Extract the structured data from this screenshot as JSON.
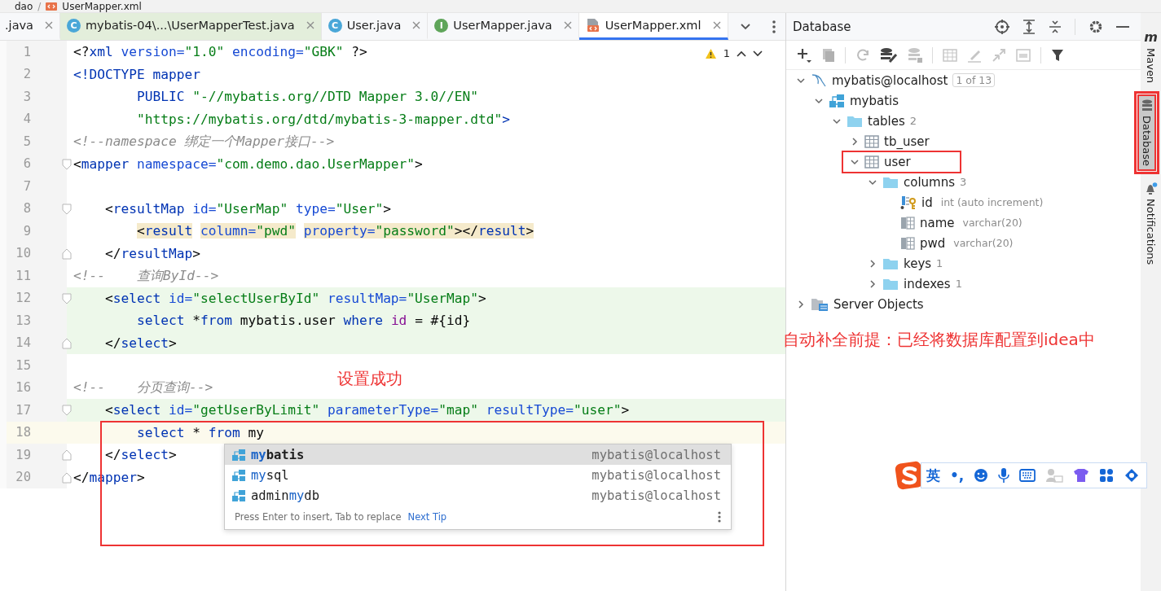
{
  "breadcrumbs": {
    "items": [
      "dao",
      "UserMapper.xml"
    ],
    "separator": "/"
  },
  "tabs": [
    {
      "label": ".java",
      "kind": "plain",
      "selected": false
    },
    {
      "label": "mybatis-04\\...\\UserMapperTest.java",
      "kind": "class",
      "glyph": "C",
      "selected": false,
      "color": "#e3eedb"
    },
    {
      "label": "User.java",
      "kind": "class",
      "glyph": "C",
      "selected": false
    },
    {
      "label": "UserMapper.java",
      "kind": "interface",
      "glyph": "I",
      "selected": false
    },
    {
      "label": "UserMapper.xml",
      "kind": "xml",
      "selected": true
    }
  ],
  "editor": {
    "warnings": {
      "count": "1"
    },
    "annotation_box": true,
    "annotation_text": "设置成功",
    "lines": [
      {
        "n": "1",
        "tokens": [
          {
            "t": "<?",
            "kind": "p"
          },
          {
            "t": "xml",
            "kind": "tag"
          },
          {
            "t": " version=",
            "kind": "attr"
          },
          {
            "t": "\"1.0\"",
            "kind": "str"
          },
          {
            "t": " encoding=",
            "kind": "attr"
          },
          {
            "t": "\"GBK\"",
            "kind": "str"
          },
          {
            "t": " ?>",
            "kind": "p"
          }
        ]
      },
      {
        "n": "2",
        "tokens": [
          {
            "t": "<!DOCTYPE mapper",
            "kind": "tag"
          }
        ]
      },
      {
        "n": "3",
        "tokens": [
          {
            "t": "        PUBLIC ",
            "kind": "tag"
          },
          {
            "t": "\"-//mybatis.org//DTD Mapper 3.0//EN\"",
            "kind": "str"
          }
        ]
      },
      {
        "n": "4",
        "tokens": [
          {
            "t": "        \"https://mybatis.org/dtd/mybatis-3-mapper.dtd\"",
            "kind": "str"
          },
          {
            "t": ">",
            "kind": "tag"
          }
        ]
      },
      {
        "n": "5",
        "tokens": [
          {
            "t": "<!--namespace 绑定一个Mapper接口-->",
            "kind": "comment"
          }
        ]
      },
      {
        "n": "6",
        "fold_open": true,
        "tokens": [
          {
            "t": "<",
            "kind": "p"
          },
          {
            "t": "mapper",
            "kind": "tag"
          },
          {
            "t": " namespace=",
            "kind": "attr"
          },
          {
            "t": "\"com.demo.dao.UserMapper\"",
            "kind": "str"
          },
          {
            "t": ">",
            "kind": "p"
          }
        ]
      },
      {
        "n": "7"
      },
      {
        "n": "8",
        "fold_open": true,
        "tokens": [
          {
            "t": "    <",
            "kind": "p"
          },
          {
            "t": "resultMap",
            "kind": "tag"
          },
          {
            "t": " id=",
            "kind": "attr"
          },
          {
            "t": "\"UserMap\"",
            "kind": "str"
          },
          {
            "t": " type=",
            "kind": "attr"
          },
          {
            "t": "\"User\"",
            "kind": "str"
          },
          {
            "t": ">",
            "kind": "p"
          }
        ]
      },
      {
        "n": "9",
        "match": true,
        "tokens": [
          {
            "t": "        <",
            "kind": "p"
          },
          {
            "t": "result",
            "kind": "tag"
          },
          {
            "t": " column=",
            "kind": "attr"
          },
          {
            "t": "\"pwd\"",
            "kind": "str"
          },
          {
            "t": " property=",
            "kind": "attr"
          },
          {
            "t": "\"password\"",
            "kind": "str"
          },
          {
            "t": "></",
            "kind": "p"
          },
          {
            "t": "result",
            "kind": "tag"
          },
          {
            "t": ">",
            "kind": "p"
          }
        ]
      },
      {
        "n": "10",
        "fold_close": true,
        "tokens": [
          {
            "t": "    </",
            "kind": "p"
          },
          {
            "t": "resultMap",
            "kind": "tag"
          },
          {
            "t": ">",
            "kind": "p"
          }
        ]
      },
      {
        "n": "11",
        "tokens": [
          {
            "t": "<!--    查询ById-->",
            "kind": "comment"
          }
        ]
      },
      {
        "n": "12",
        "fold_open": true,
        "injected": true,
        "tokens": [
          {
            "t": "    <",
            "kind": "p"
          },
          {
            "t": "select",
            "kind": "tag"
          },
          {
            "t": " id=",
            "kind": "attr"
          },
          {
            "t": "\"selectUserById\"",
            "kind": "str"
          },
          {
            "t": " resultMap=",
            "kind": "attr"
          },
          {
            "t": "\"UserMap\"",
            "kind": "str"
          },
          {
            "t": ">",
            "kind": "p"
          }
        ]
      },
      {
        "n": "13",
        "injected": true,
        "tokens": [
          {
            "t": "        select",
            "kind": "kw"
          },
          {
            "t": " *",
            "kind": "p"
          },
          {
            "t": "from",
            "kind": "kw"
          },
          {
            "t": " mybatis.user ",
            "kind": "p"
          },
          {
            "t": "where",
            "kind": "kw"
          },
          {
            "t": " id",
            "kind": "field"
          },
          {
            "t": " = #{id}",
            "kind": "p"
          }
        ]
      },
      {
        "n": "14",
        "fold_close": true,
        "injected": true,
        "tokens": [
          {
            "t": "    </",
            "kind": "p"
          },
          {
            "t": "select",
            "kind": "tag"
          },
          {
            "t": ">",
            "kind": "p"
          }
        ]
      },
      {
        "n": "15"
      },
      {
        "n": "16",
        "tokens": [
          {
            "t": "<!--    分页查询-->",
            "kind": "comment"
          }
        ]
      },
      {
        "n": "17",
        "fold_open": true,
        "injected": true,
        "tokens": [
          {
            "t": "    <",
            "kind": "p"
          },
          {
            "t": "select",
            "kind": "tag"
          },
          {
            "t": " id=",
            "kind": "attr"
          },
          {
            "t": "\"getUserByLimit\"",
            "kind": "str"
          },
          {
            "t": " parameterType=",
            "kind": "attr"
          },
          {
            "t": "\"map\"",
            "kind": "str"
          },
          {
            "t": " resultType=",
            "kind": "attr"
          },
          {
            "t": "\"user\"",
            "kind": "str"
          },
          {
            "t": ">",
            "kind": "p"
          }
        ]
      },
      {
        "n": "18",
        "current": true,
        "tokens": [
          {
            "t": "        select",
            "kind": "kw"
          },
          {
            "t": " * ",
            "kind": "p"
          },
          {
            "t": "from",
            "kind": "kw"
          },
          {
            "t": " my",
            "kind": "p"
          }
        ]
      },
      {
        "n": "19",
        "fold_close": true,
        "tokens": [
          {
            "t": "    </",
            "kind": "p"
          },
          {
            "t": "select",
            "kind": "tag"
          },
          {
            "t": ">",
            "kind": "p"
          }
        ]
      },
      {
        "n": "20",
        "fold_close": true,
        "tokens": [
          {
            "t": "</",
            "kind": "p"
          },
          {
            "t": "mapper",
            "kind": "tag"
          },
          {
            "t": ">",
            "kind": "p"
          }
        ]
      }
    ],
    "completion": {
      "items": [
        {
          "match": "my",
          "rest": "batis",
          "source": "mybatis@localhost",
          "selected": true
        },
        {
          "match": "my",
          "rest": "sql",
          "source": "mybatis@localhost",
          "selected": false
        },
        {
          "prefix": "admin",
          "match": "my",
          "rest": "db",
          "source": "mybatis@localhost",
          "selected": false
        }
      ],
      "hint": "Press Enter to insert, Tab to replace",
      "link": "Next Tip"
    }
  },
  "database": {
    "title": "Database",
    "annotation_text": "自动补全前提：已经将数据库配置到idea中",
    "tree": [
      {
        "name": "mybatis@localhost",
        "kind": "datasource",
        "badge": "1 of 13",
        "expanded": true,
        "children": [
          {
            "name": "mybatis",
            "kind": "schema",
            "expanded": true,
            "children": [
              {
                "name": "tables",
                "kind": "folder",
                "count": "2",
                "expanded": true,
                "children": [
                  {
                    "name": "tb_user",
                    "kind": "table",
                    "expanded": false
                  },
                  {
                    "name": "user",
                    "kind": "table",
                    "expanded": true,
                    "outlined": true,
                    "children": [
                      {
                        "name": "columns",
                        "kind": "folder",
                        "count": "3",
                        "expanded": true,
                        "children": [
                          {
                            "name": "id",
                            "kind": "key-column",
                            "detail": "int (auto increment)"
                          },
                          {
                            "name": "name",
                            "kind": "column",
                            "detail": "varchar(20)"
                          },
                          {
                            "name": "pwd",
                            "kind": "column",
                            "detail": "varchar(20)"
                          }
                        ]
                      },
                      {
                        "name": "keys",
                        "kind": "folder",
                        "count": "1",
                        "expanded": false
                      },
                      {
                        "name": "indexes",
                        "kind": "folder",
                        "count": "1",
                        "expanded": false
                      }
                    ]
                  }
                ]
              }
            ]
          }
        ]
      },
      {
        "name": "Server Objects",
        "kind": "server",
        "expanded": false
      }
    ]
  },
  "side_strip": [
    {
      "label": "Maven",
      "glyph": "m",
      "kind": "maven",
      "selected": false,
      "outlined": false
    },
    {
      "label": "Database",
      "kind": "database",
      "selected": true,
      "outlined": true
    },
    {
      "label": "Notifications",
      "kind": "bell",
      "selected": false,
      "outlined": false
    }
  ],
  "ime_bar": {
    "mode": "英",
    "punct": "•,"
  }
}
